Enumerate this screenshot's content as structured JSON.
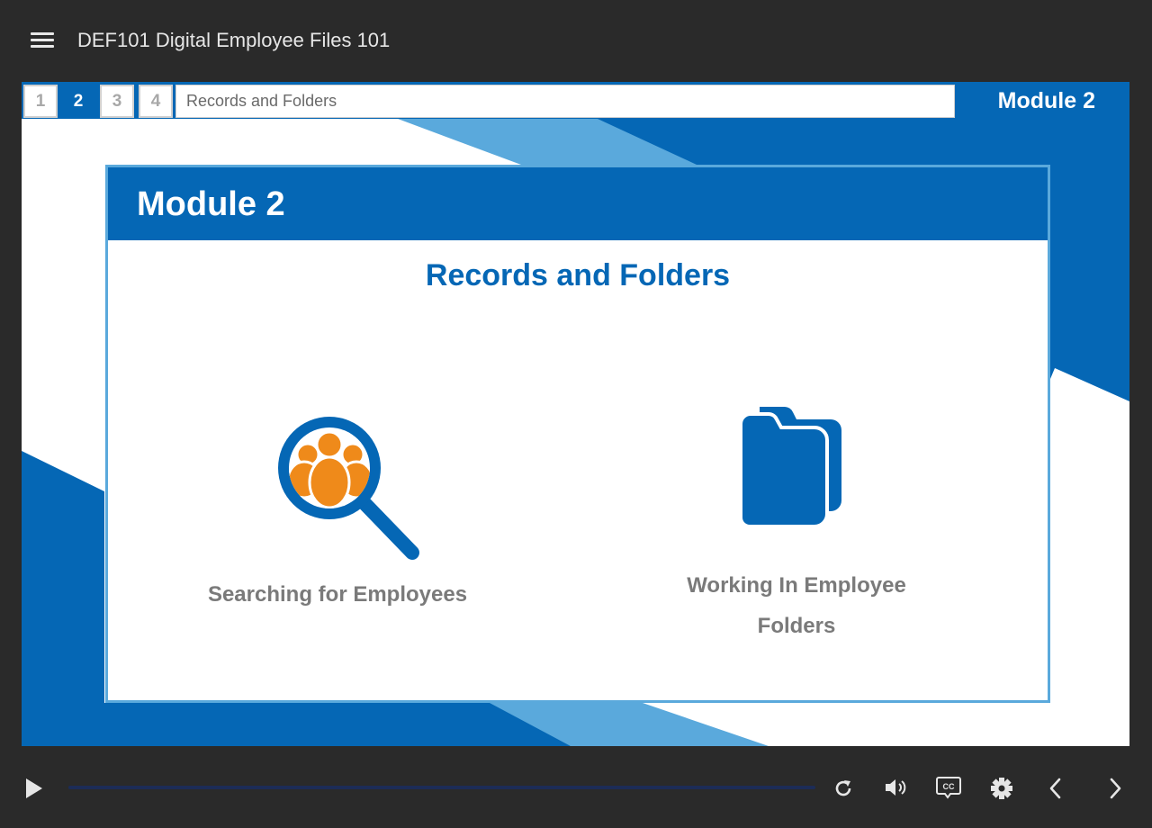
{
  "app": {
    "course_title": "DEF101 Digital Employee Files 101"
  },
  "slide": {
    "tabs": [
      "1",
      "2",
      "3",
      "4"
    ],
    "active_tab": "2",
    "topic_title": "Records and Folders",
    "corner_label": "Module 2",
    "card": {
      "heading": "Module 2",
      "subtitle": "Records and Folders",
      "options": [
        {
          "label": "Searching for Employees",
          "icon": "magnifier-people-icon"
        },
        {
          "label": "Working In Employee Folders",
          "icon": "folder-icon"
        }
      ]
    }
  },
  "player": {
    "progress": 0,
    "icons": [
      "play-icon",
      "replay-icon",
      "volume-icon",
      "captions-icon",
      "settings-icon",
      "previous-icon",
      "next-icon"
    ]
  },
  "colors": {
    "primary_blue": "#0567b5",
    "light_blue": "#5aa9dc",
    "accent_orange": "#ef8a1a",
    "chrome_dark": "#2a2a2a",
    "label_gray": "#7a7a7a"
  }
}
